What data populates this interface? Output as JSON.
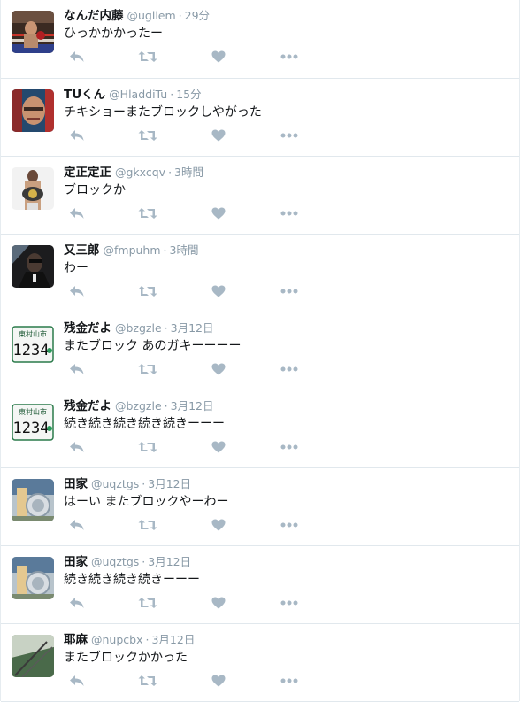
{
  "colors": {
    "name": "#14171a",
    "meta": "#8899a6",
    "icon": "#a8b8c5",
    "divider": "#e1e8ed"
  },
  "icons": {
    "reply": "reply-icon",
    "retweet": "retweet-icon",
    "like": "heart-icon",
    "more": "more-icon"
  },
  "tweets": [
    {
      "name": "なんだ内藤",
      "handle": "@ugllem",
      "sep": "·",
      "time": "29分",
      "text": "ひっかかかったー",
      "avatar": "boxing-ring-photo"
    },
    {
      "name": "TUくん",
      "handle": "@HladdiTu",
      "sep": "·",
      "time": "15分",
      "text": "チキショーまたブロックしやがった",
      "avatar": "face-photo"
    },
    {
      "name": "定正定正",
      "handle": "@gkxcqv",
      "sep": "·",
      "time": "3時間",
      "text": "ブロックか",
      "avatar": "champion-belt-photo"
    },
    {
      "name": "又三郎",
      "handle": "@fmpuhm",
      "sep": "·",
      "time": "3時間",
      "text": "わー",
      "avatar": "dark-portrait-photo"
    },
    {
      "name": "残金だよ",
      "handle": "@bzgzle",
      "sep": "·",
      "time": "3月12日",
      "text": "またブロック あのガキーーーー",
      "avatar": "license-plate",
      "plate_city": "東村山市",
      "plate_number": "1234"
    },
    {
      "name": "残金だよ",
      "handle": "@bzgzle",
      "sep": "·",
      "time": "3月12日",
      "text": "続き続き続き続き続きーーー",
      "avatar": "license-plate",
      "plate_city": "東村山市",
      "plate_number": "1234"
    },
    {
      "name": "田家",
      "handle": "@uqztgs",
      "sep": "·",
      "time": "3月12日",
      "text": "はーい またブロックやーわー",
      "avatar": "interior-photo"
    },
    {
      "name": "田家",
      "handle": "@uqztgs",
      "sep": "·",
      "time": "3月12日",
      "text": "続き続き続き続きーーー",
      "avatar": "interior-photo"
    },
    {
      "name": "耶麻",
      "handle": "@nupcbx",
      "sep": "·",
      "time": "3月12日",
      "text": "またブロックかかった",
      "avatar": "landscape-photo"
    }
  ]
}
